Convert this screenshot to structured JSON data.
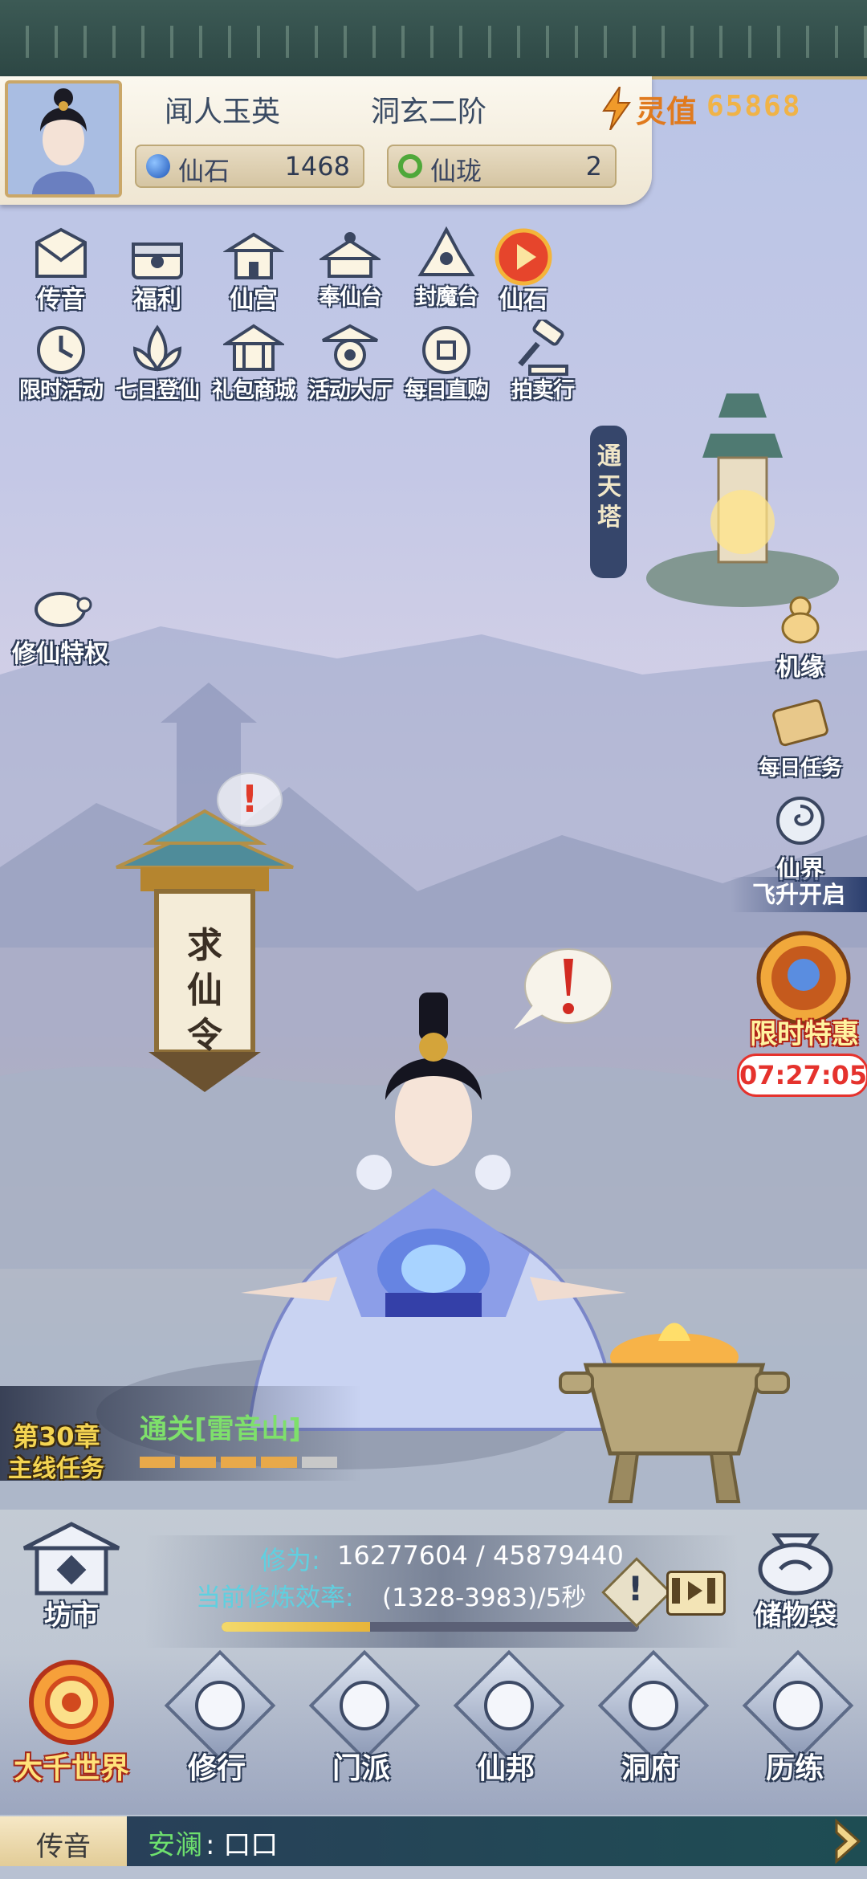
{
  "player": {
    "name": "闻人玉英",
    "realm": "洞玄二阶",
    "power_label": "灵值",
    "power_value": "65868"
  },
  "resources": [
    {
      "label": "仙石",
      "value": "1468",
      "icon": "gem-icon",
      "color": "#2f6fd6"
    },
    {
      "label": "仙珑",
      "value": "2",
      "icon": "ring-icon",
      "color": "#4fa83a"
    }
  ],
  "features_row1": [
    {
      "label": "传音",
      "icon": "envelope-icon"
    },
    {
      "label": "福利",
      "icon": "gift-box-icon"
    },
    {
      "label": "仙宫",
      "icon": "palace-icon"
    },
    {
      "label": "奉仙台",
      "icon": "altar-icon"
    },
    {
      "label": "封魔台",
      "icon": "seal-tower-icon"
    },
    {
      "label": "仙石",
      "icon": "play-icon"
    }
  ],
  "features_row2": [
    {
      "label": "限时活动",
      "icon": "timer-icon"
    },
    {
      "label": "七日登仙",
      "icon": "lotus-icon"
    },
    {
      "label": "礼包商城",
      "icon": "shop-icon"
    },
    {
      "label": "活动大厅",
      "icon": "hall-icon"
    },
    {
      "label": "每日直购",
      "icon": "coin-icon"
    },
    {
      "label": "拍卖行",
      "icon": "gavel-icon"
    }
  ],
  "left_side": {
    "label": "修仙特权",
    "icon": "turtle-icon"
  },
  "tower": {
    "label": "通天塔"
  },
  "right_side": [
    {
      "label": "机缘",
      "icon": "gourd-icon"
    },
    {
      "label": "每日任务",
      "icon": "scroll-icon"
    },
    {
      "label": "仙界",
      "icon": "vortex-icon",
      "sub": "飞升开启"
    },
    {
      "label": "限时特惠",
      "icon": "treasure-icon",
      "timer": "07:27:05"
    }
  ],
  "quest_board": {
    "label": "求仙令"
  },
  "quest": {
    "chapter": "第30章",
    "type": "主线任务",
    "objective": "通关[雷音山]",
    "progress_segments_filled": 4,
    "progress_segments_total": 5
  },
  "cultivation": {
    "label": "修为:",
    "value": "16277604 / 45879440",
    "rate_label": "当前修炼效率:",
    "rate_value": "(1328-3983)/5秒",
    "progress": 0.355
  },
  "market": {
    "label": "坊市"
  },
  "storage": {
    "label": "储物袋"
  },
  "nav": [
    {
      "label": "大千世界",
      "icon": "world-icon"
    },
    {
      "label": "修行",
      "icon": "cultivate-icon"
    },
    {
      "label": "门派",
      "icon": "sect-icon"
    },
    {
      "label": "仙邦",
      "icon": "alliance-icon"
    },
    {
      "label": "洞府",
      "icon": "cave-icon"
    },
    {
      "label": "历练",
      "icon": "training-icon"
    }
  ],
  "chat": {
    "tab": "传音",
    "speaker": "安澜",
    "message": ": 口口"
  },
  "colors": {
    "accent": "#e07a1e",
    "power": "#f0b347",
    "chat_speaker": "#6ee06e",
    "timer": "#e5322d",
    "objective": "#7ee06b"
  }
}
